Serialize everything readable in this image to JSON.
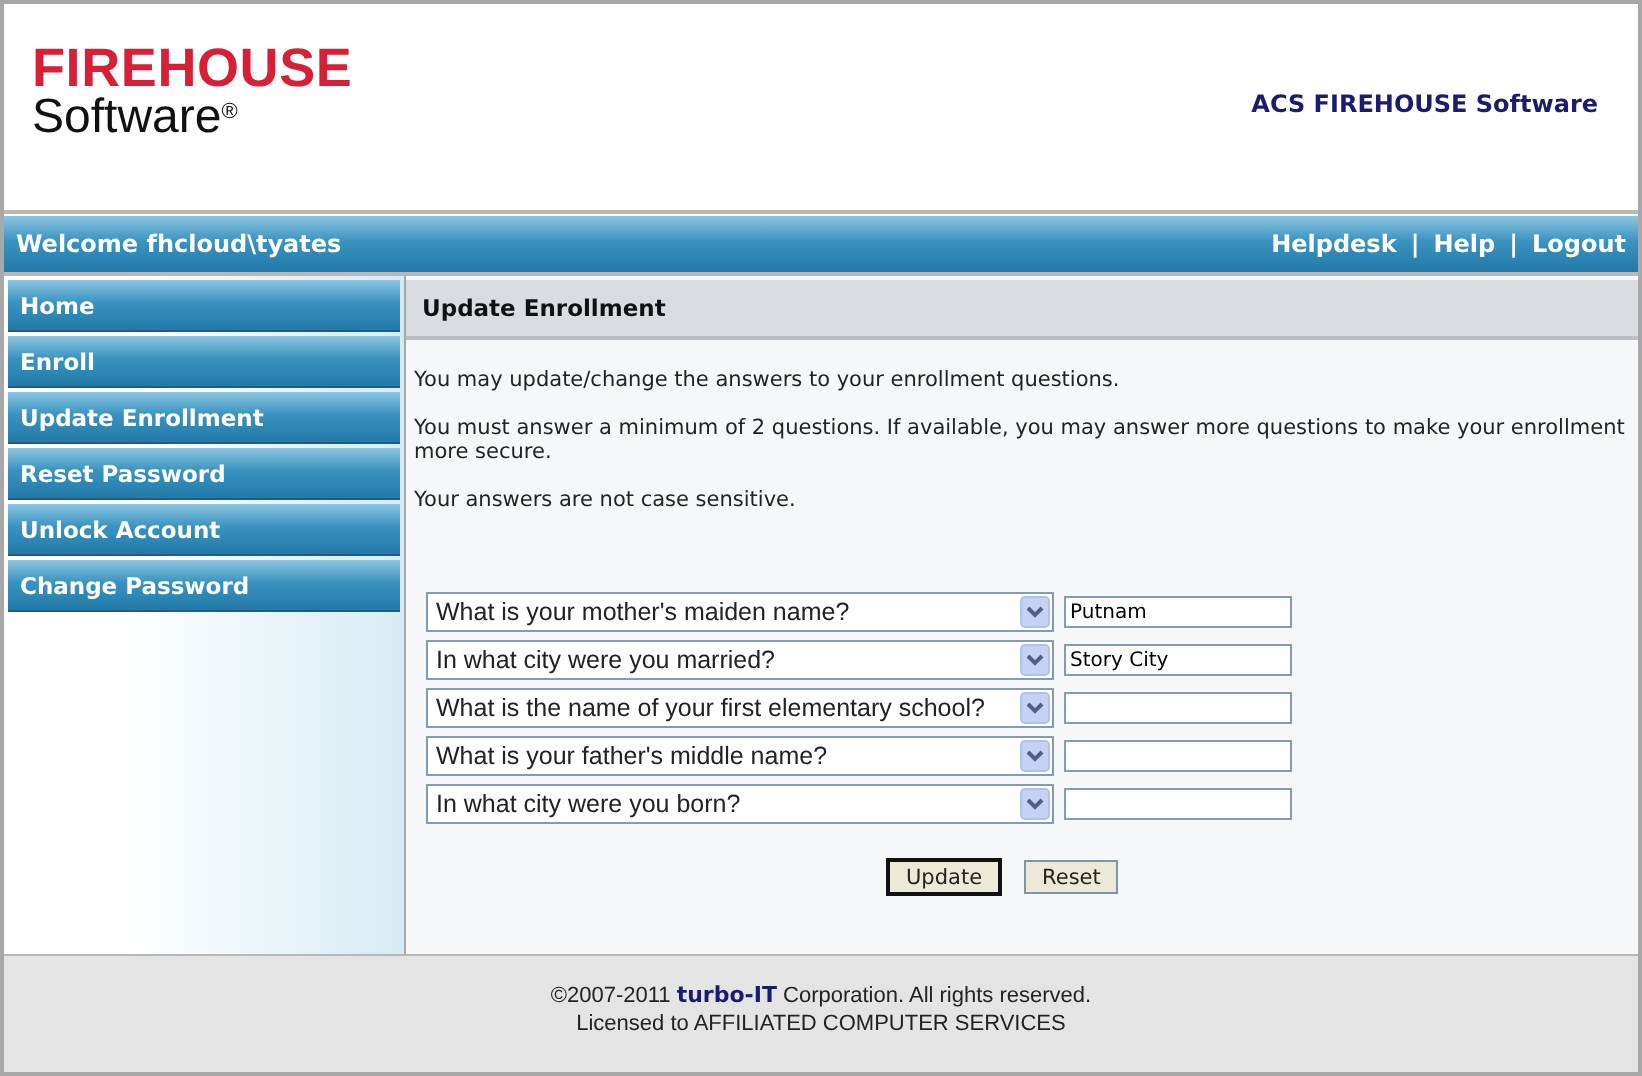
{
  "header": {
    "logo_top": "FIREHOUSE",
    "logo_bottom": "Software$^{®}$",
    "product": "ACS FIREHOUSE Software"
  },
  "welcome_bar": {
    "welcome": "Welcome fhcloud\\tyates",
    "links": [
      "Helpdesk",
      "Help",
      "Logout"
    ],
    "separator": "|"
  },
  "sidebar": {
    "items": [
      "Home",
      "Enroll",
      "Update Enrollment",
      "Reset Password",
      "Unlock Account",
      "Change Password"
    ]
  },
  "content": {
    "title": "Update Enrollment",
    "paragraphs": [
      "You may update/change the answers to your enrollment questions.",
      "You must answer a minimum of 2 questions. If available, you may answer more questions to make your enrollment more secure.",
      "Your answers are not case sensitive."
    ],
    "questions": [
      {
        "question": "What is your mother's maiden name?",
        "answer": "Putnam"
      },
      {
        "question": "In what city were you married?",
        "answer": "Story City"
      },
      {
        "question": "What is the name of your first elementary school?"
      },
      {
        "question": "What is your father's middle name?"
      },
      {
        "question": "In what city were you born?"
      }
    ],
    "buttons": [
      "Update",
      "Reset"
    ]
  },
  "footer": {
    "copyright": "©2007-2011 **turbo-IT** Corporation. All rights reserved.",
    "license": "Licensed to AFFILIATED COMPUTER SERVICES"
  }
}
